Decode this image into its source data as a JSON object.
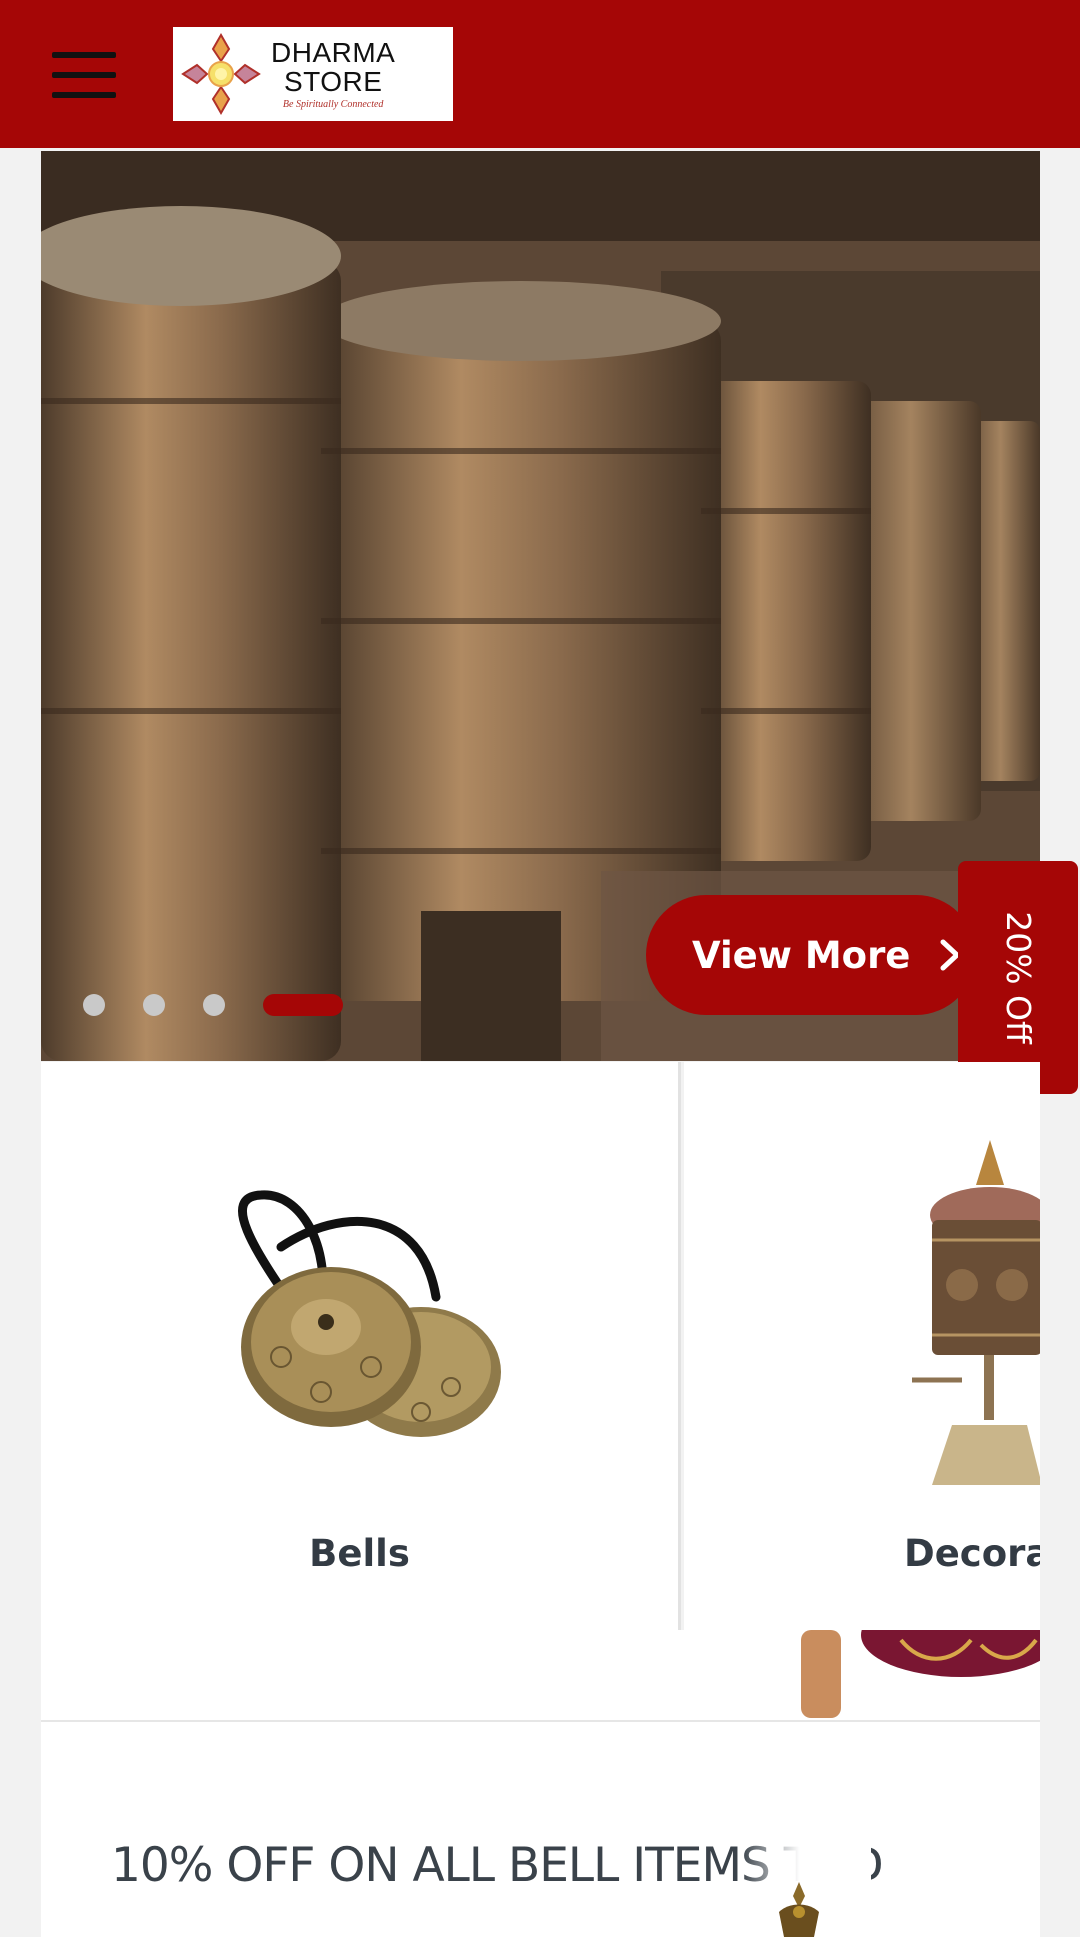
{
  "header": {
    "menu_icon": "hamburger-menu-icon",
    "logo": {
      "name_line1": "DHARMA",
      "name_line2": "STORE",
      "tagline": "Be Spiritually Connected"
    }
  },
  "hero": {
    "image": "prayer-wheels-photo",
    "slides_total": 4,
    "active_slide": 4,
    "cta_label": "View More",
    "cta_icon": "chevron-right-icon"
  },
  "side_tab": {
    "label": "20% Off"
  },
  "categories": [
    {
      "label": "Bells",
      "image": "tingsha-cymbals-image"
    },
    {
      "label": "Decorat",
      "image": "prayer-wheel-image"
    }
  ],
  "promo": {
    "title": "10% OFF ON ALL BELL ITEMS TOD"
  },
  "colors": {
    "brand": "#a50606",
    "text": "#333b44",
    "background": "#f2f2f2"
  }
}
